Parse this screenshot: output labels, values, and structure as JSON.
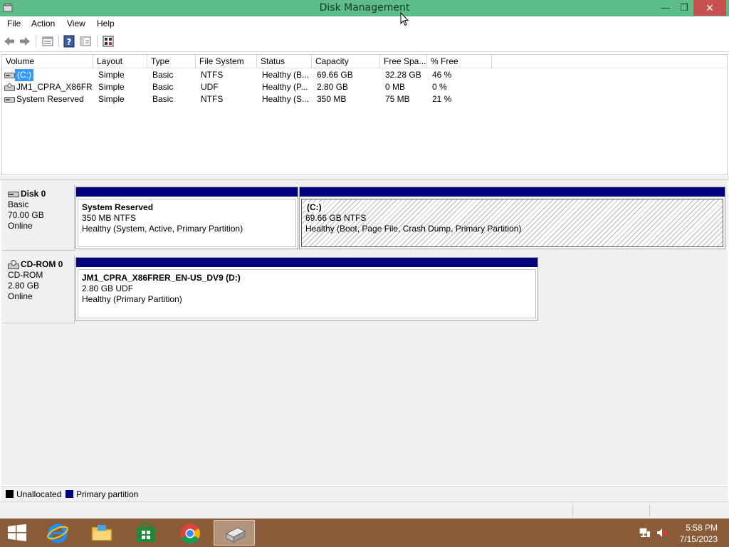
{
  "window": {
    "title": "Disk Management",
    "minimize_glyph": "—",
    "restore_glyph": "❐",
    "close_glyph": "✕"
  },
  "menu": [
    "File",
    "Action",
    "View",
    "Help"
  ],
  "toolbar_icons": [
    "back-arrow-icon",
    "forward-arrow-icon",
    "properties-icon",
    "help-icon",
    "console-tree-icon",
    "settings-icon"
  ],
  "columns": [
    "Volume",
    "Layout",
    "Type",
    "File System",
    "Status",
    "Capacity",
    "Free Spa...",
    "% Free"
  ],
  "volumes": [
    {
      "volume": "(C:)",
      "layout": "Simple",
      "type": "Basic",
      "fs": "NTFS",
      "status": "Healthy (B...",
      "capacity": "69.66 GB",
      "free": "32.28 GB",
      "pct": "46 %",
      "icon": "hard-disk-icon",
      "selected": true
    },
    {
      "volume": "JM1_CPRA_X86FR...",
      "layout": "Simple",
      "type": "Basic",
      "fs": "UDF",
      "status": "Healthy (P...",
      "capacity": "2.80 GB",
      "free": "0 MB",
      "pct": "0 %",
      "icon": "cdrom-icon",
      "selected": false
    },
    {
      "volume": "System Reserved",
      "layout": "Simple",
      "type": "Basic",
      "fs": "NTFS",
      "status": "Healthy (S...",
      "capacity": "350 MB",
      "free": "75 MB",
      "pct": "21 %",
      "icon": "hard-disk-icon",
      "selected": false
    }
  ],
  "disks": [
    {
      "name": "Disk 0",
      "kind": "Basic",
      "size": "70.00 GB",
      "state": "Online",
      "partitions": [
        {
          "title": "System Reserved",
          "line2": "350 MB NTFS",
          "line3": "Healthy (System, Active, Primary Partition)"
        },
        {
          "title": "(C:)",
          "line2": "69.66 GB NTFS",
          "line3": "Healthy (Boot, Page File, Crash Dump, Primary Partition)"
        }
      ]
    },
    {
      "name": "CD-ROM 0",
      "kind": "CD-ROM",
      "size": "2.80 GB",
      "state": "Online",
      "partitions": [
        {
          "title": "JM1_CPRA_X86FRER_EN-US_DV9  (D:)",
          "line2": "2.80 GB UDF",
          "line3": "Healthy (Primary Partition)"
        }
      ]
    }
  ],
  "legend": [
    {
      "label": "Unallocated",
      "color": "#000000"
    },
    {
      "label": "Primary partition",
      "color": "#00007f"
    }
  ],
  "taskbar": {
    "apps": [
      "windows-start-icon",
      "internet-explorer-icon",
      "file-explorer-icon",
      "store-icon",
      "chrome-icon",
      "disk-management-icon"
    ],
    "time": "5:58 PM",
    "date": "7/15/2023"
  },
  "colors": {
    "titlebar": "#5cbd88",
    "primary_partition": "#00007f",
    "selection": "#3399ff",
    "taskbar": "#8a5c3a",
    "close_button": "#c75050"
  }
}
